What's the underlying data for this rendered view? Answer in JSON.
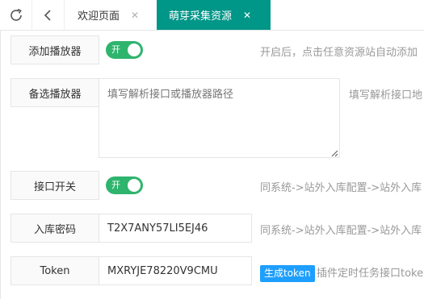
{
  "tabs": [
    {
      "label": "欢迎页面",
      "close": "✕",
      "active": false
    },
    {
      "label": "萌芽采集资源",
      "close": "✕",
      "active": true
    }
  ],
  "form": {
    "add_player": {
      "label": "添加播放器",
      "switch_text": "开",
      "switch_on": true,
      "hint": "开启后，点击任意资源站自动添加"
    },
    "backup_player": {
      "label": "备选播放器",
      "placeholder": "填写解析接口或播放器路径",
      "value": "",
      "hint": "填写解析接口地"
    },
    "api_switch": {
      "label": "接口开关",
      "switch_text": "开",
      "switch_on": true,
      "hint": "同系统->站外入库配置->站外入库"
    },
    "storage_password": {
      "label": "入库密码",
      "value": "T2X7ANY57LI5EJ46",
      "hint": "同系统->站外入库配置->站外入库"
    },
    "token": {
      "label": "Token",
      "value": "MXRYJE78220V9CMU",
      "button": "生成token",
      "hint": "插件定时任务接口toke"
    }
  },
  "colors": {
    "active_tab": "#009688",
    "switch_on": "#2fb46e",
    "generate_button": "#1e9fff"
  }
}
